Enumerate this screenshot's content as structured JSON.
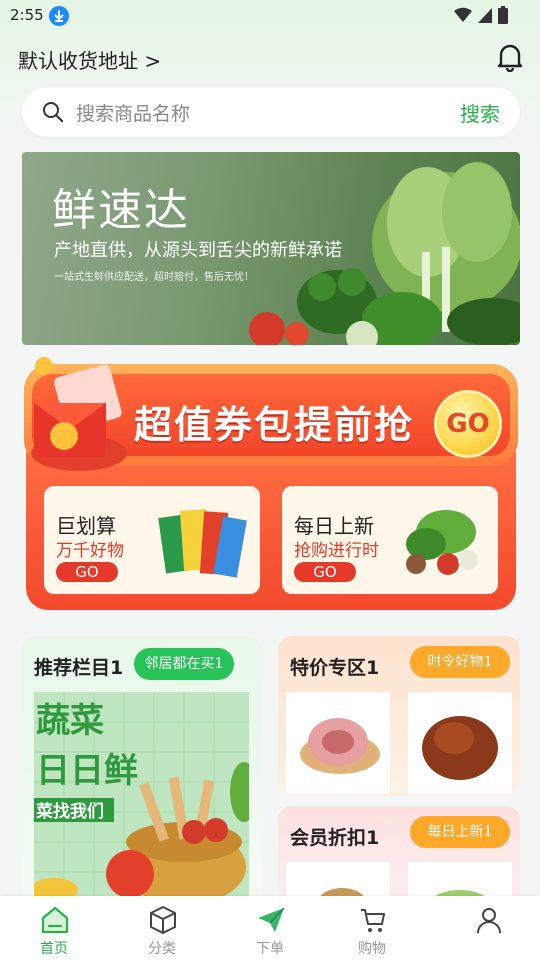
{
  "status_bar": {
    "time": "2:55"
  },
  "header": {
    "address": "默认收货地址 >"
  },
  "search": {
    "placeholder": "搜索商品名称",
    "button": "搜索"
  },
  "banner": {
    "title": "鲜速达",
    "subtitle": "产地直供，从源头到舌尖的新鲜承诺",
    "small_text": "一站式生鲜供应配送，超时赔付，售后无忧！"
  },
  "coupon": {
    "title": "超值券包提前抢",
    "go": "GO",
    "cards": [
      {
        "title": "巨划算",
        "subtitle": "万千好物",
        "go": "GO"
      },
      {
        "title": "每日上新",
        "subtitle": "抢购进行时",
        "go": "GO"
      }
    ]
  },
  "sections": {
    "recommend": {
      "title": "推荐栏目1",
      "tag": "邻居都在买1"
    },
    "special": {
      "title": "特价专区1",
      "tag": "时令好物1"
    },
    "member": {
      "title": "会员折扣1",
      "tag": "每日上新1"
    }
  },
  "tabbar": {
    "items": [
      {
        "label": "首页",
        "icon": "home-icon",
        "active": true
      },
      {
        "label": "分类",
        "icon": "box-icon",
        "active": false
      },
      {
        "label": "下单",
        "icon": "send-icon",
        "active": false
      },
      {
        "label": "购物",
        "icon": "cart-icon",
        "active": false
      },
      {
        "label": "",
        "icon": "user-icon",
        "active": false
      }
    ]
  },
  "colors": {
    "accent": "#27b24a",
    "coupon_red": "#f2452a",
    "tag_orange": "#ffa82a"
  }
}
